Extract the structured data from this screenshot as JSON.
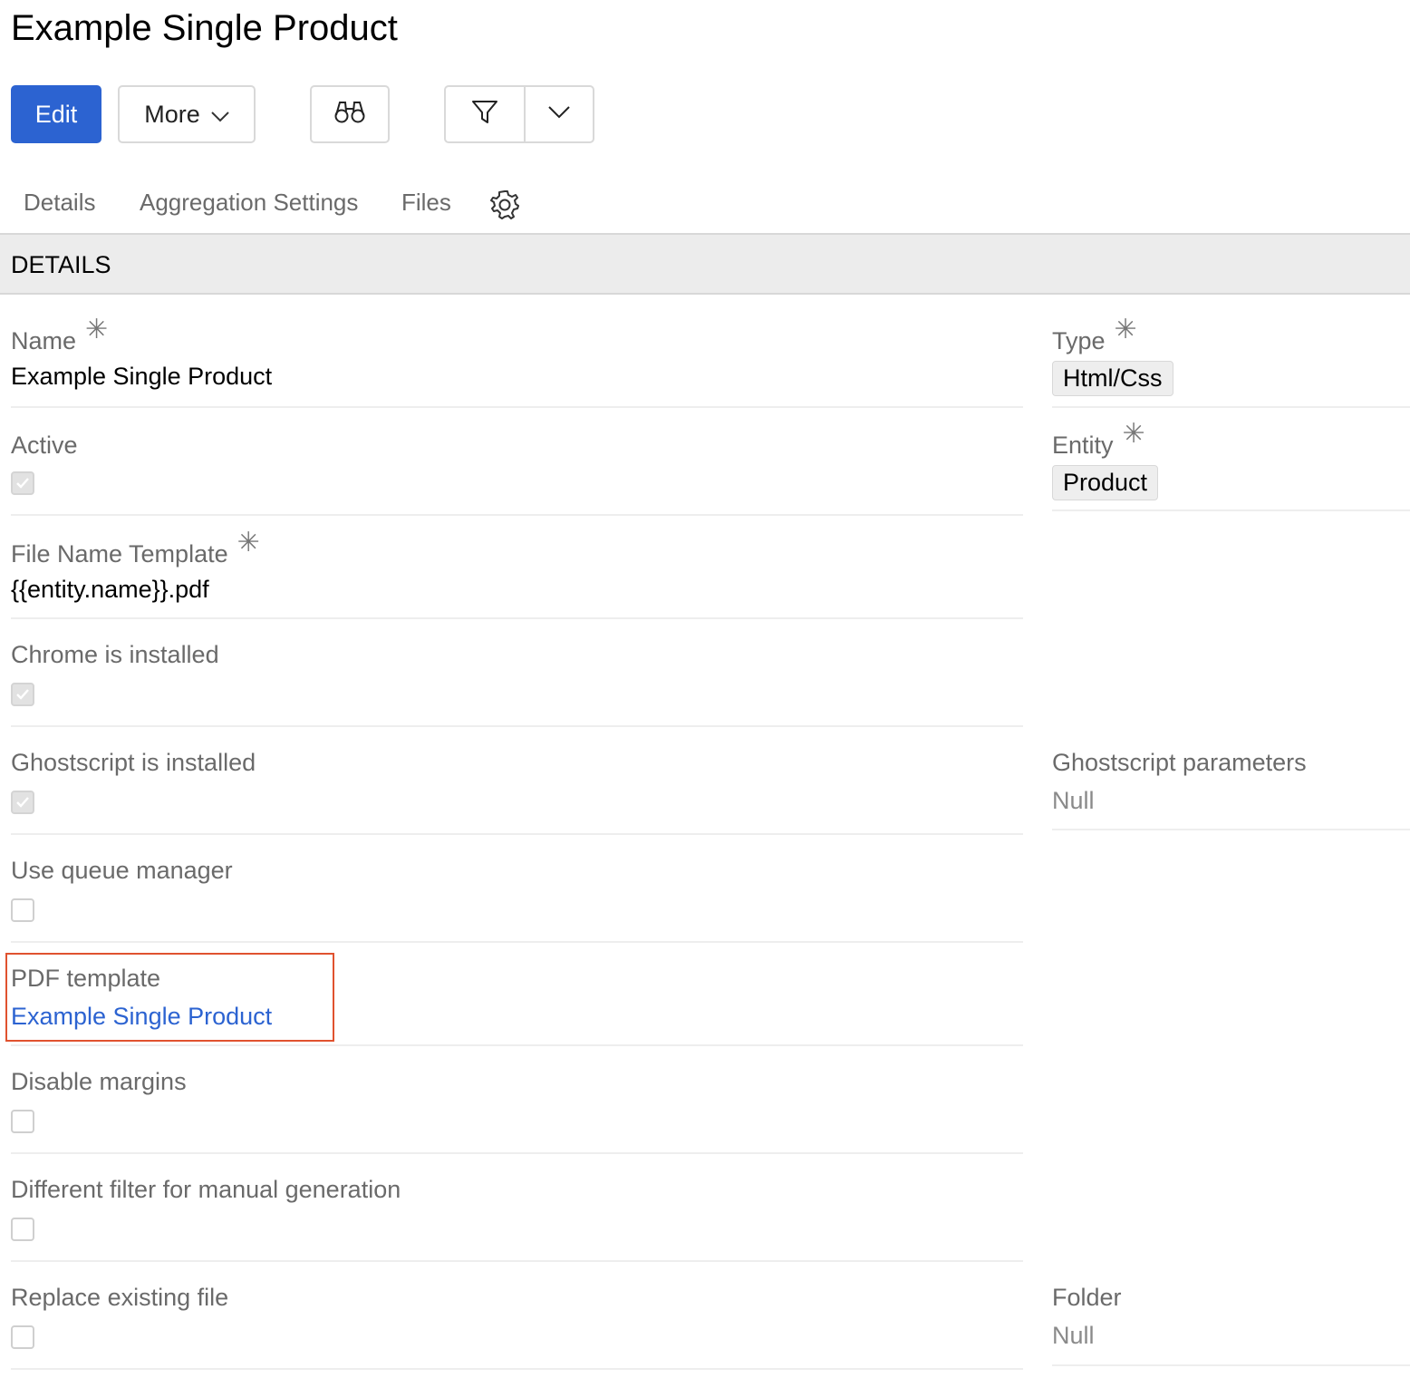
{
  "header": {
    "title": "Example Single Product"
  },
  "toolbar": {
    "edit_label": "Edit",
    "more_label": "More",
    "search_icon": "binoculars-icon",
    "filter_icon": "filter-icon",
    "dropdown_icon": "chevron-down-icon"
  },
  "tabs": [
    {
      "label": "Details"
    },
    {
      "label": "Aggregation Settings"
    },
    {
      "label": "Files"
    }
  ],
  "section": {
    "title": "DETAILS"
  },
  "fields": {
    "name": {
      "label": "Name",
      "value": "Example Single Product",
      "required": "✳"
    },
    "type": {
      "label": "Type",
      "value": "Html/Css",
      "required": "✳"
    },
    "active": {
      "label": "Active",
      "checked": true
    },
    "entity": {
      "label": "Entity",
      "value": "Product",
      "required": "✳"
    },
    "file_name_template": {
      "label": "File Name Template",
      "value": "{{entity.name}}.pdf",
      "required": "✳"
    },
    "chrome_installed": {
      "label": "Chrome is installed",
      "checked": true
    },
    "ghostscript_installed": {
      "label": "Ghostscript is installed",
      "checked": true
    },
    "ghostscript_parameters": {
      "label": "Ghostscript parameters",
      "value": "Null"
    },
    "use_queue_manager": {
      "label": "Use queue manager",
      "checked": false
    },
    "pdf_template": {
      "label": "PDF template",
      "value": "Example Single Product"
    },
    "disable_margins": {
      "label": "Disable margins",
      "checked": false
    },
    "different_filter": {
      "label": "Different filter for manual generation",
      "checked": false
    },
    "replace_existing": {
      "label": "Replace existing file",
      "checked": false
    },
    "folder": {
      "label": "Folder",
      "value": "Null"
    }
  },
  "colors": {
    "primary": "#2c63d1",
    "highlight": "#e0522f"
  }
}
